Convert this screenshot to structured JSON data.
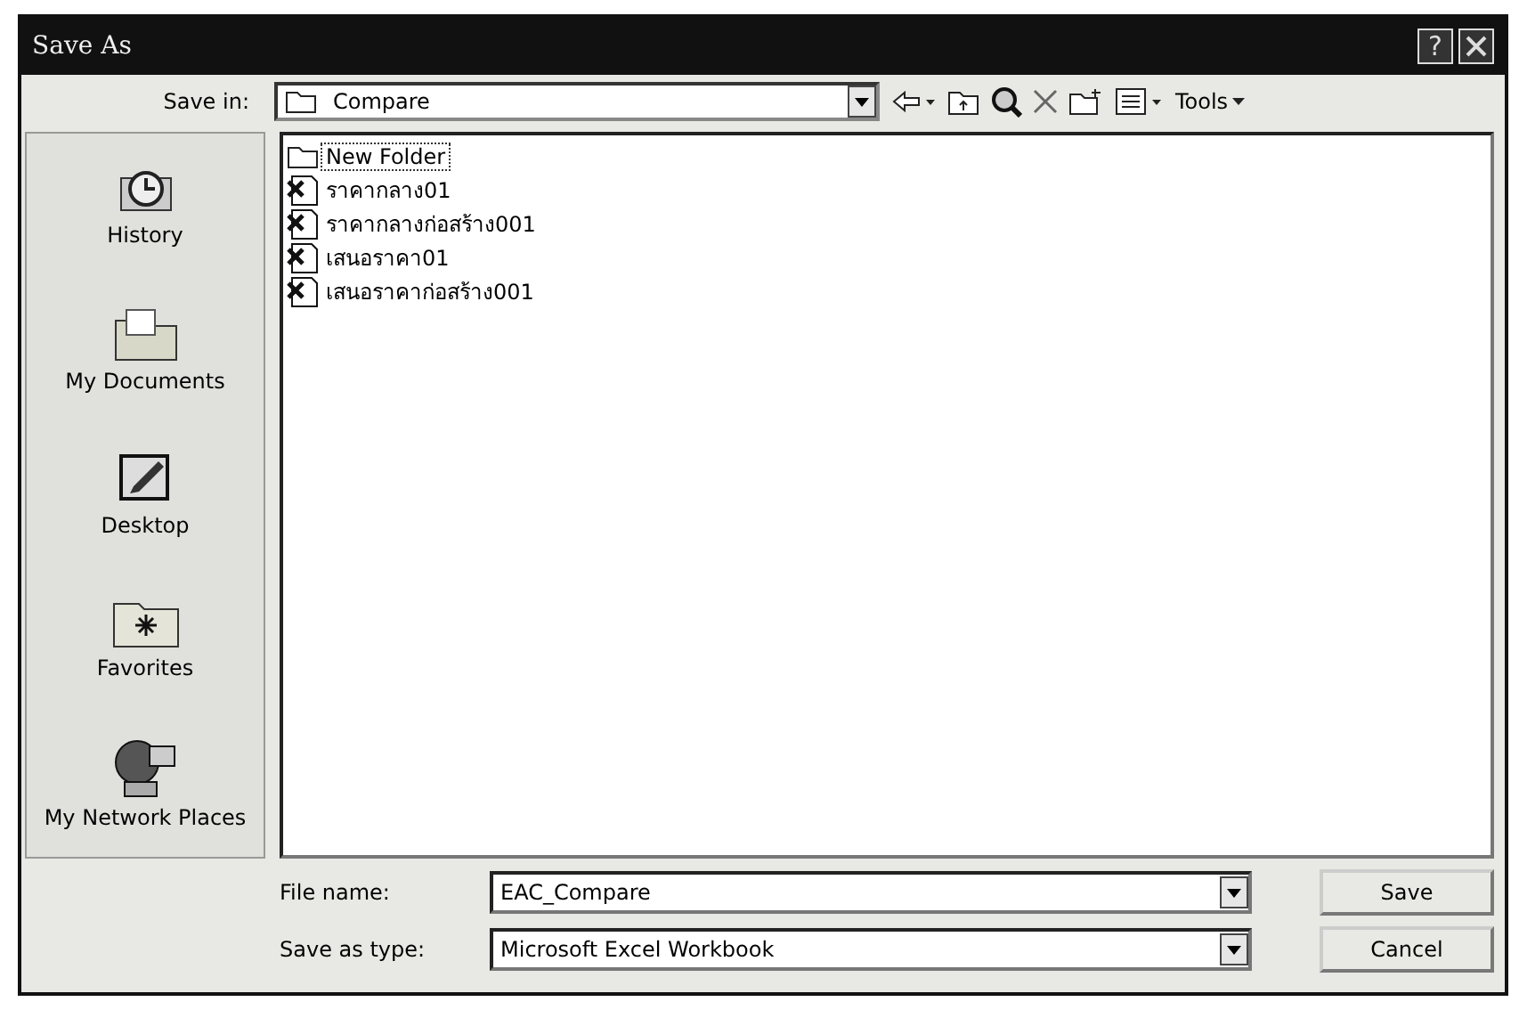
{
  "window": {
    "title": "Save As",
    "help": "?"
  },
  "toolbar": {
    "label": "Save in:",
    "location": "Compare",
    "tools": "Tools"
  },
  "places": [
    {
      "label": "History",
      "kind": "history"
    },
    {
      "label": "My Documents",
      "kind": "documents"
    },
    {
      "label": "Desktop",
      "kind": "desktop"
    },
    {
      "label": "Favorites",
      "kind": "favorites"
    },
    {
      "label": "My Network Places",
      "kind": "network"
    }
  ],
  "files": [
    {
      "name": "New Folder",
      "kind": "folder",
      "selected": true
    },
    {
      "name": "ราคากลาง01",
      "kind": "workbook",
      "selected": false
    },
    {
      "name": "ราคากลางก่อสร้าง001",
      "kind": "workbook",
      "selected": false
    },
    {
      "name": "เสนอราคา01",
      "kind": "workbook",
      "selected": false
    },
    {
      "name": "เสนอราคาก่อสร้าง001",
      "kind": "workbook",
      "selected": false
    }
  ],
  "file_name": {
    "label": "File name:",
    "value": "EAC_Compare"
  },
  "save_type": {
    "label": "Save as type:",
    "value": "Microsoft Excel Workbook"
  },
  "buttons": [
    "Save",
    "Cancel"
  ]
}
